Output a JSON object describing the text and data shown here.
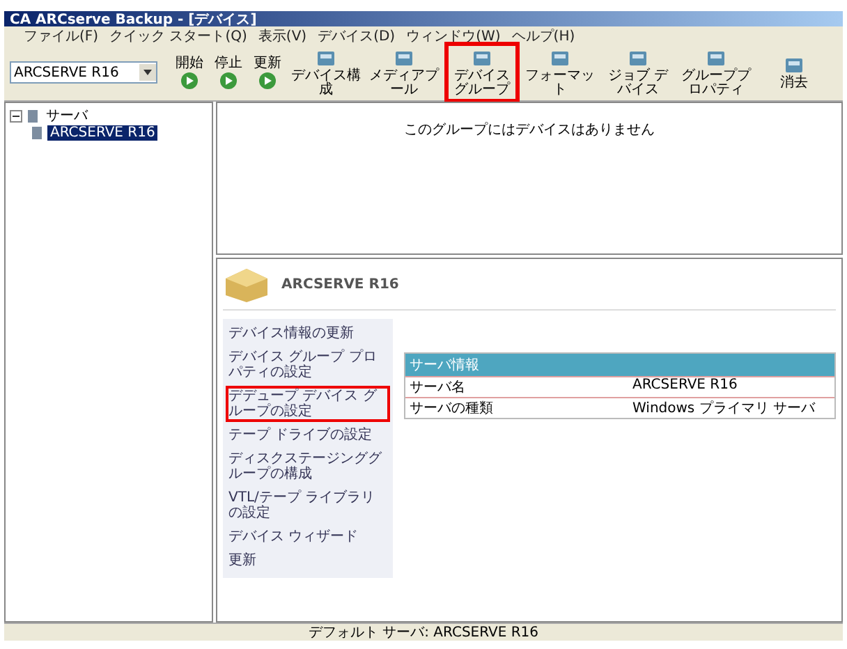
{
  "window": {
    "title": "CA ARCserve Backup - [デバイス]"
  },
  "menu": [
    "ファイル(F)",
    "クイック スタート(Q)",
    "表示(V)",
    "デバイス(D)",
    "ウィンドウ(W)",
    "ヘルプ(H)"
  ],
  "server_select": {
    "value": "ARCSERVE R16"
  },
  "run_buttons": [
    {
      "label": "開始"
    },
    {
      "label": "停止"
    },
    {
      "label": "更新"
    }
  ],
  "toolbar": [
    {
      "label": "デバイス構成",
      "highlighted": false
    },
    {
      "label": "メディアプール",
      "highlighted": false
    },
    {
      "label": "デバイスグループ",
      "highlighted": true
    },
    {
      "label": "フォーマット",
      "highlighted": false
    },
    {
      "label": "ジョブ デバイス",
      "highlighted": false
    },
    {
      "label": "グループプロパティ",
      "highlighted": false
    },
    {
      "label": "消去",
      "highlighted": false
    }
  ],
  "tree": [
    {
      "label": "サーバ",
      "expanded": true,
      "selected": false,
      "children": [
        {
          "label": "ARCSERVE R16",
          "selected": true
        }
      ]
    }
  ],
  "empty_message": "このグループにはデバイスはありません",
  "server_header": "ARCSERVE R16",
  "tasks": [
    {
      "label": "デバイス情報の更新",
      "highlighted": false
    },
    {
      "label": "デバイス グループ プロパティの設定",
      "highlighted": false
    },
    {
      "label": "デデュープ デバイス グループの設定",
      "highlighted": true
    },
    {
      "label": "テープ ドライブの設定",
      "highlighted": false
    },
    {
      "label": "ディスクステージンググループの構成",
      "highlighted": false
    },
    {
      "label": "VTL/テープ ライブラリの設定",
      "highlighted": false
    },
    {
      "label": "デバイス ウィザード",
      "highlighted": false
    },
    {
      "label": "更新",
      "highlighted": false
    }
  ],
  "info_table": {
    "title": "サーバ情報",
    "rows": [
      [
        "サーバ名",
        "ARCSERVE R16"
      ],
      [
        "サーバの種類",
        "Windows プライマリ サーバ"
      ]
    ]
  },
  "status_bar": {
    "text": "デフォルト サーバ: ARCSERVE R16"
  }
}
